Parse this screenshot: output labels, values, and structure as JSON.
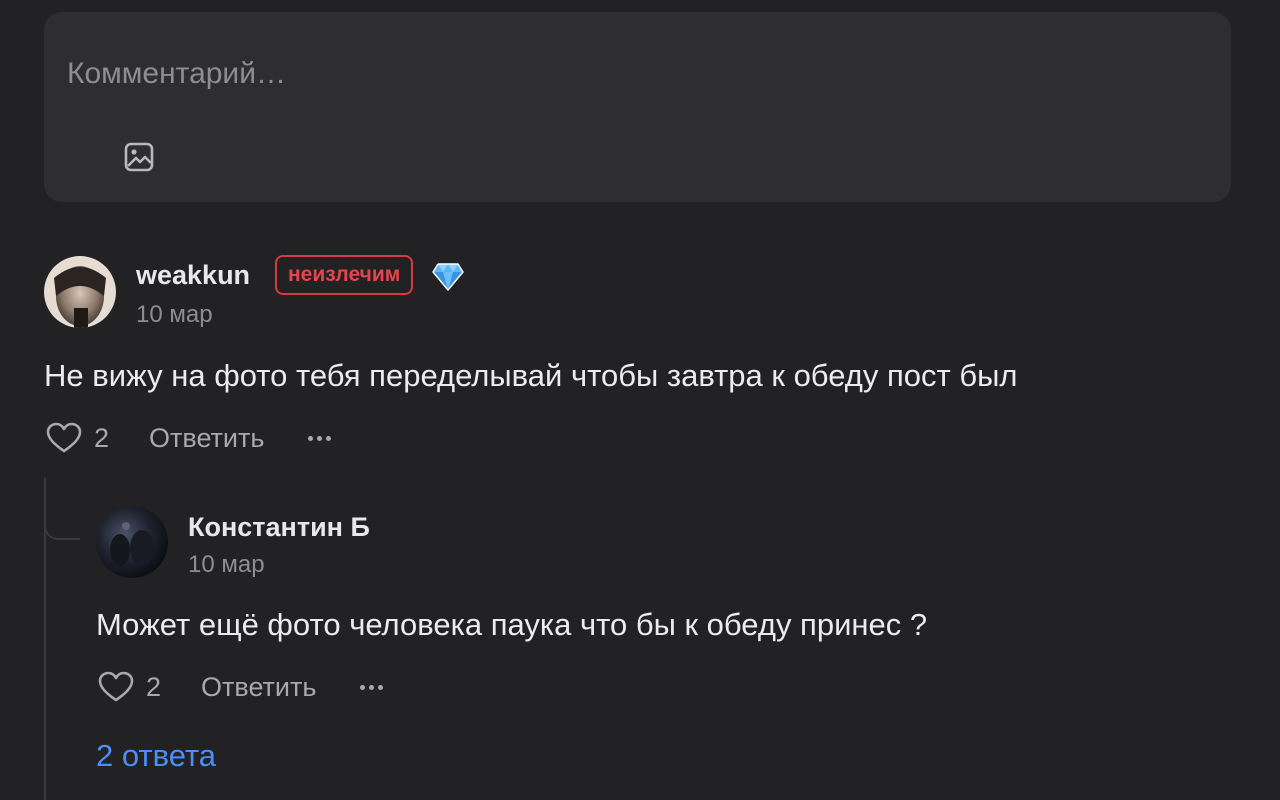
{
  "composer": {
    "placeholder": "Комментарий…",
    "attach_image_icon": "image-icon"
  },
  "comments": [
    {
      "author": "weakkun",
      "badge": "неизлечим",
      "badge_color": "#d73a3f",
      "premium_icon": "diamond-icon",
      "date": "10 мар",
      "text": "Не вижу на фото тебя переделывай чтобы завтра к обеду пост был",
      "likes": "2",
      "reply_label": "Ответить",
      "more_icon": "more-icon"
    },
    {
      "author": "Константин Б",
      "date": "10 мар",
      "text": "Может ещё фото человека паука что бы к обеду принес ?",
      "likes": "2",
      "reply_label": "Ответить",
      "more_icon": "more-icon",
      "replies_link": "2 ответа"
    }
  ],
  "colors": {
    "background": "#222224",
    "composer_bg": "#2e2e31",
    "link": "#4c8df6",
    "badge": "#e5454a"
  }
}
